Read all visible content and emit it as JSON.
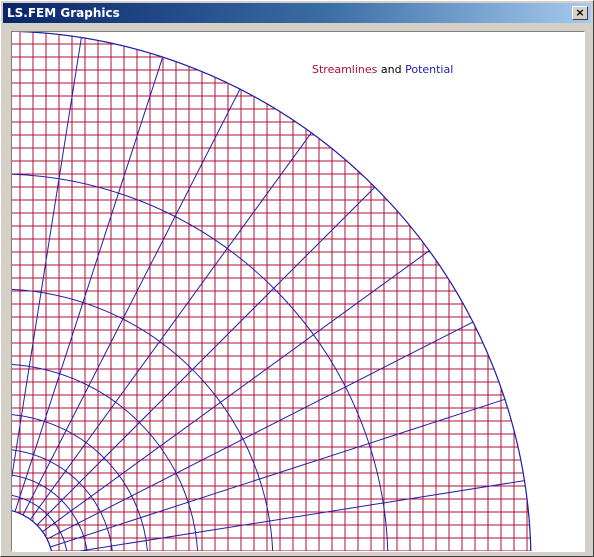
{
  "window": {
    "title": "LS.FEM Graphics",
    "close_icon": "close-icon",
    "close_glyph": "×"
  },
  "legend": {
    "streamlines": "Streamlines",
    "connector": "and",
    "potential": "Potential"
  },
  "colors": {
    "streamlines": "#b0103a",
    "potential": "#2020a8",
    "text": "#000000"
  }
}
